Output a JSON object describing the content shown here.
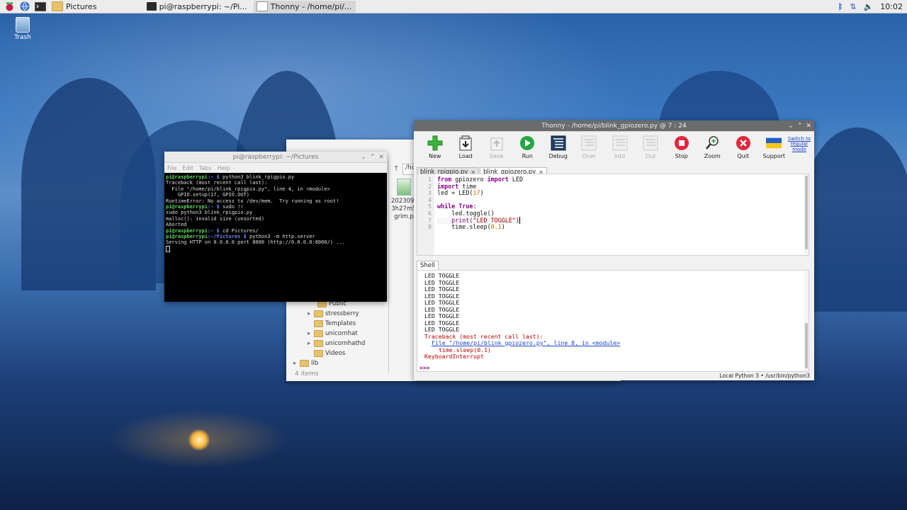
{
  "taskbar": {
    "buttons": [
      {
        "label": "Pictures"
      },
      {
        "label": "pi@raspberrypi: ~/Pi..."
      },
      {
        "label": "Thonny  -  /home/pi/..."
      }
    ],
    "clock": "10:02"
  },
  "desktop": {
    "trash_label": "Trash"
  },
  "terminal": {
    "title": "pi@raspberrypi: ~/Pictures",
    "menu": [
      "File",
      "Edit",
      "Tabs",
      "Help"
    ],
    "lines": [
      {
        "user": "pi@raspberrypi",
        "path": ":~ $",
        "text": " python3 blink_rpigpio.py"
      },
      {
        "text": "Traceback (most recent call last):"
      },
      {
        "text": "  File \"/home/pi/blink_rpigpio.py\", line 4, in <module>"
      },
      {
        "text": "    GPIO.setup(17, GPIO.OUT)"
      },
      {
        "text": "RuntimeError: No access to /dev/mem.  Try running as root!"
      },
      {
        "user": "pi@raspberrypi",
        "path": ":~ $",
        "text": " sudo !!"
      },
      {
        "text": "sudo python3 blink_rpigpio.py"
      },
      {
        "text": "malloc(): invalid size (unsorted)"
      },
      {
        "text": "Aborted"
      },
      {
        "user": "pi@raspberrypi",
        "path": ":~ $",
        "text": " cd Pictures/"
      },
      {
        "user": "pi@raspberrypi",
        "path": ":~/Pictures $",
        "text": " python3 -m http.server"
      },
      {
        "text": "Serving HTTP on 0.0.0.0 port 8000 (http://0.0.0.0:8000/) ..."
      }
    ]
  },
  "filemanager": {
    "path_text": "/ho",
    "file": {
      "name_lines": [
        "2023092",
        "3h27m5",
        "grim.p"
      ]
    },
    "tree": [
      {
        "label": "Public",
        "arrow": ""
      },
      {
        "label": "stressberry",
        "arrow": "▸"
      },
      {
        "label": "Templates",
        "arrow": ""
      },
      {
        "label": "unicornhat",
        "arrow": "▸"
      },
      {
        "label": "unicornhathd",
        "arrow": "▸"
      },
      {
        "label": "Videos",
        "arrow": ""
      },
      {
        "label": "lib",
        "arrow": "▸"
      }
    ],
    "status": "4 items"
  },
  "thonny": {
    "title": "Thonny  -  /home/pi/blink_gpiozero.py  @  7 : 24",
    "toolbar": [
      {
        "label": "New",
        "icon": "plus-icon",
        "enabled": true
      },
      {
        "label": "Load",
        "icon": "load-icon",
        "enabled": true
      },
      {
        "label": "Save",
        "icon": "save-icon",
        "enabled": false
      },
      {
        "label": "Run",
        "icon": "run-icon",
        "enabled": true
      },
      {
        "label": "Debug",
        "icon": "debug-icon",
        "enabled": true
      },
      {
        "label": "Over",
        "icon": "step-over-icon",
        "enabled": false
      },
      {
        "label": "Into",
        "icon": "step-into-icon",
        "enabled": false
      },
      {
        "label": "Out",
        "icon": "step-out-icon",
        "enabled": false
      },
      {
        "label": "Stop",
        "icon": "stop-icon",
        "enabled": true
      },
      {
        "label": "Zoom",
        "icon": "zoom-icon",
        "enabled": true
      },
      {
        "label": "Quit",
        "icon": "quit-icon",
        "enabled": true
      },
      {
        "label": "Support",
        "icon": "ukraine-flag-icon",
        "enabled": true
      }
    ],
    "switch_link": "Switch to regular mode",
    "tabs": [
      {
        "label": "blink_rpigpio.py",
        "active": false
      },
      {
        "label": "blink_gpiozero.py",
        "active": true
      }
    ],
    "line_numbers": [
      "1",
      "2",
      "3",
      "4",
      "5",
      "6",
      "7",
      "8"
    ],
    "code": {
      "l1_kw1": "from",
      "l1_mod": " gpiozero ",
      "l1_kw2": "import",
      "l1_name": " LED",
      "l2_kw": "import",
      "l2_mod": " time",
      "l3_a": "led = LED(",
      "l3_num": "17",
      "l3_b": ")",
      "l5_kw1": "while",
      "l5_kw2": "True",
      "l5_b": ":",
      "l6": "    led.toggle()",
      "l7_a": "    print(",
      "l7_str": "\"LED TOGGLE\"",
      "l7_b": ")",
      "l8_a": "    time.sleep(",
      "l8_num": "0.1",
      "l8_b": ")"
    },
    "shell_tab": "Shell",
    "shell_output": [
      "LED TOGGLE",
      "LED TOGGLE",
      "LED TOGGLE",
      "LED TOGGLE",
      "LED TOGGLE",
      "LED TOGGLE",
      "LED TOGGLE",
      "LED TOGGLE",
      "LED TOGGLE"
    ],
    "traceback": {
      "header": "Traceback (most recent call last):",
      "file_link": "File \"/home/pi/blink_gpiozero.py\", line 8, in <module>",
      "code_line": "time.sleep(0.1)",
      "error": "KeyboardInterrupt"
    },
    "prompt": ">>>",
    "status": "Local Python 3  •  /usr/bin/python3"
  }
}
